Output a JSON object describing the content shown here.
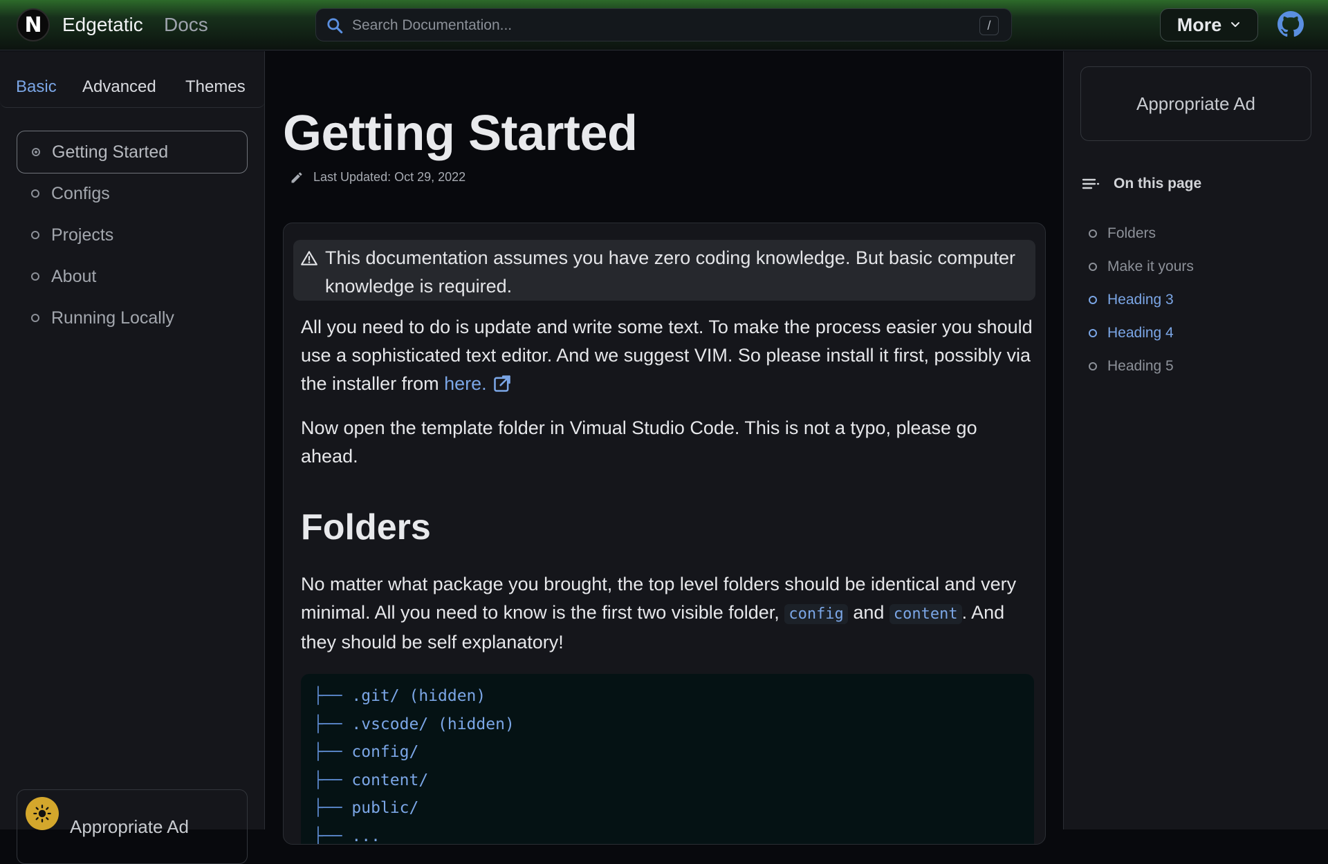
{
  "header": {
    "logo_letter": "N",
    "brand": "Edgetatic",
    "section": "Docs",
    "search_placeholder": "Search Documentation...",
    "search_shortcut": "/",
    "more_label": "More"
  },
  "sidebar": {
    "tabs": [
      {
        "label": "Basic",
        "active": true
      },
      {
        "label": "Advanced",
        "active": false
      },
      {
        "label": "Themes",
        "active": false
      }
    ],
    "items": [
      {
        "label": "Getting Started",
        "active": true
      },
      {
        "label": "Configs",
        "active": false
      },
      {
        "label": "Projects",
        "active": false
      },
      {
        "label": "About",
        "active": false
      },
      {
        "label": "Running Locally",
        "active": false
      }
    ],
    "ad_label": "Appropriate Ad"
  },
  "main": {
    "title": "Getting Started",
    "last_updated": "Last Updated: Oct 29, 2022",
    "note": "This documentation assumes you have zero coding knowledge. But basic computer knowledge is required.",
    "para1_text": "All you need to do is update and write some text. To make the process easier you should use a sophisticated text editor. And we suggest VIM. So please install it first, possibly via the installer from",
    "para1_link": "here.",
    "para2": "Now open the template folder in Vimual Studio Code. This is not a typo, please go ahead.",
    "folders_heading": "Folders",
    "para3_a": "No matter what package you brought, the top level folders should be identical and very minimal. All you need to know is the first two visible folder,",
    "para3_code1": "config",
    "para3_b": "and",
    "para3_code2": "content",
    "para3_c": ". And they should be self explanatory!",
    "code_lines": [
      ".git/ (hidden)",
      ".vscode/ (hidden)",
      "config/",
      "content/",
      "public/",
      "..."
    ],
    "code_prefix": "├── "
  },
  "right": {
    "ad_label": "Appropriate Ad",
    "toc_title": "On this page",
    "toc": [
      {
        "label": "Folders",
        "highlight": false
      },
      {
        "label": "Make it yours",
        "highlight": false
      },
      {
        "label": "Heading 3",
        "highlight": true
      },
      {
        "label": "Heading 4",
        "highlight": true
      },
      {
        "label": "Heading 5",
        "highlight": false
      }
    ]
  },
  "colors": {
    "accent": "#7ba6e6",
    "header_green": "#2d6a2a",
    "ad_icon_yellow": "#d4a72c"
  }
}
